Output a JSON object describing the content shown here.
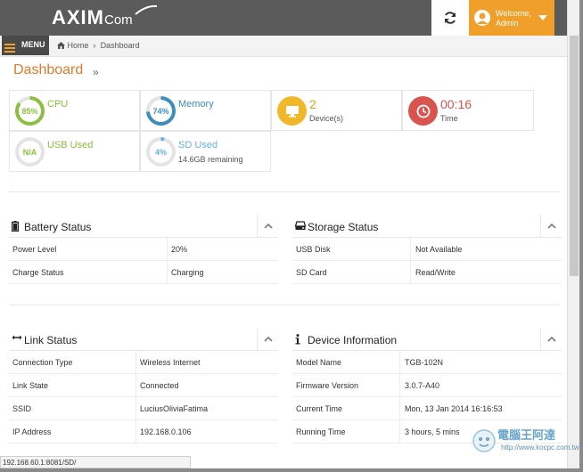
{
  "header": {
    "logo_main": "AXIM",
    "logo_sub": "Com",
    "welcome_line1": "Welcome,",
    "welcome_line2": "Admin"
  },
  "breadcrumb": {
    "menu_label": "MENU",
    "home": "Home",
    "current": "Dashboard"
  },
  "page_title": "Dashboard",
  "page_title_chevron": "»",
  "stats": {
    "cpu": {
      "value": "85%",
      "label": "CPU",
      "percent": 85,
      "color": "#8cbf3f"
    },
    "memory": {
      "value": "74%",
      "label": "Memory",
      "percent": 74,
      "color": "#3c8dbc"
    },
    "devices": {
      "value": "2",
      "label": "Device(s)",
      "color": "#f0b82a"
    },
    "time": {
      "value": "00:16",
      "label": "Time",
      "color": "#d9534f"
    },
    "usb": {
      "value": "N/A",
      "label": "USB Used",
      "color": "#8cbf3f"
    },
    "sd": {
      "value": "4%",
      "label": "SD Used",
      "sub": "14.6GB remaining",
      "percent": 4,
      "color": "#6ab0de"
    }
  },
  "battery": {
    "title": "Battery Status",
    "rows": [
      {
        "k": "Power Level",
        "v": "20%"
      },
      {
        "k": "Charge Status",
        "v": "Charging"
      }
    ]
  },
  "storage": {
    "title": "Storage Status",
    "rows": [
      {
        "k": "USB Disk",
        "v": "Not Available"
      },
      {
        "k": "SD Card",
        "v": "Read/Write"
      }
    ]
  },
  "link": {
    "title": "Link Status",
    "rows": [
      {
        "k": "Connection Type",
        "v": "Wireless Internet"
      },
      {
        "k": "Link State",
        "v": "Connected"
      },
      {
        "k": "SSID",
        "v": "LuciusOliviaFatima"
      },
      {
        "k": "IP Address",
        "v": "192.168.0.106"
      }
    ]
  },
  "device": {
    "title": "Device Information",
    "rows": [
      {
        "k": "Model Name",
        "v": "TGB-102N"
      },
      {
        "k": "Firmware Version",
        "v": "3.0.7-A40"
      },
      {
        "k": "Current Time",
        "v": "Mon, 13 Jan 2014 16:16:53"
      },
      {
        "k": "Running Time",
        "v": "3 hours, 5 mins"
      }
    ]
  },
  "status_url": "192.168.60.1:8081/SD/",
  "watermark": {
    "text": "電腦王阿達",
    "url": "http://www.kocpc.com.tw"
  },
  "colors": {
    "accent": "#f0a02a",
    "title": "#e07a2a",
    "topbar": "#5b5b5b"
  }
}
